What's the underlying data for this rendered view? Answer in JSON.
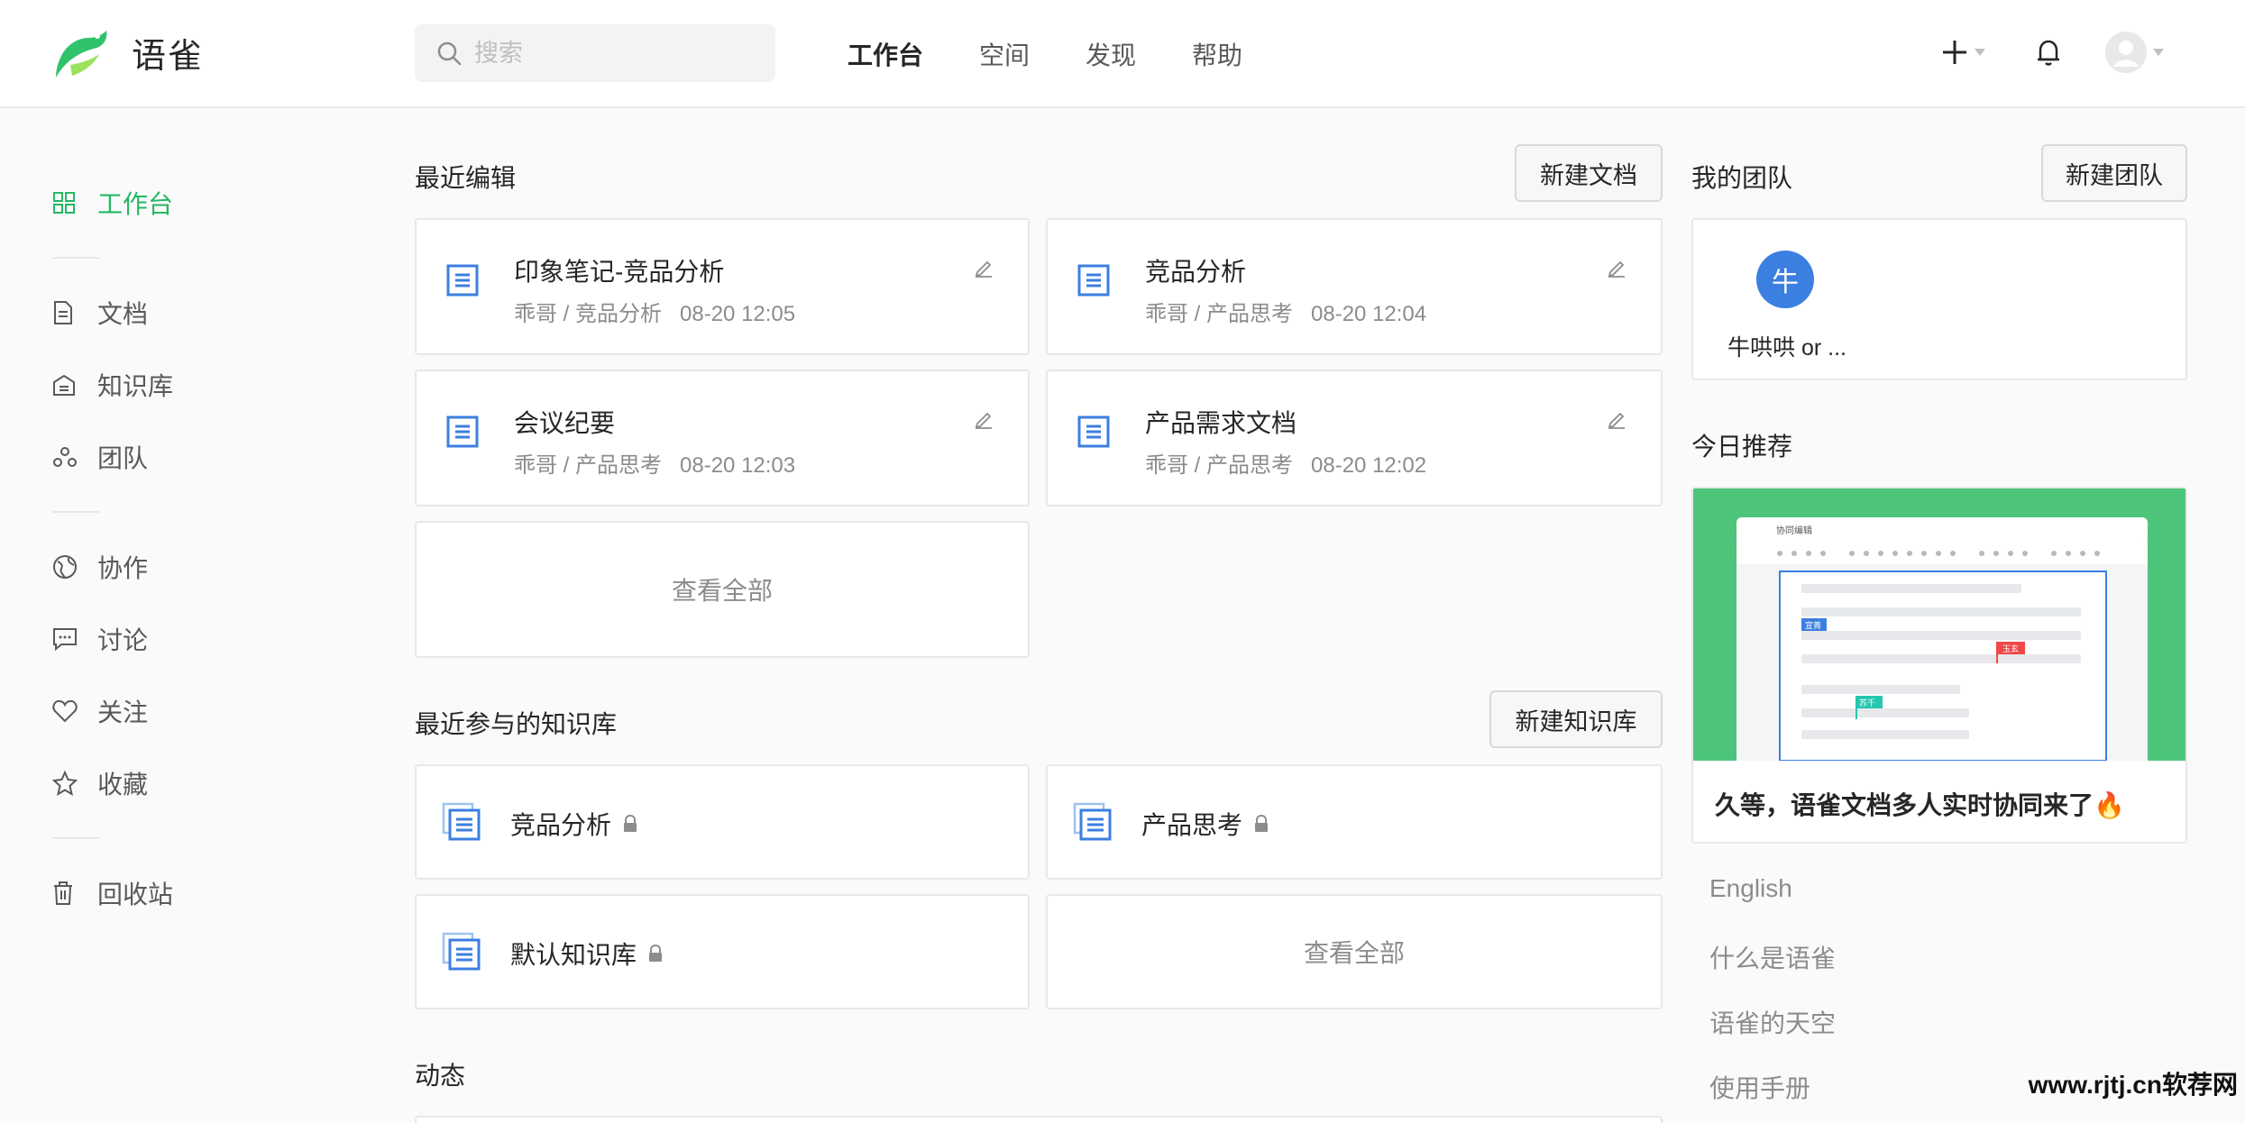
{
  "app": {
    "name": "语雀"
  },
  "search": {
    "placeholder": "搜索"
  },
  "nav": [
    {
      "label": "工作台",
      "active": true
    },
    {
      "label": "空间"
    },
    {
      "label": "发现"
    },
    {
      "label": "帮助"
    }
  ],
  "header_icons": [
    "plus-icon",
    "bell-icon",
    "avatar"
  ],
  "sidebar": {
    "items": [
      {
        "label": "工作台",
        "icon": "grid-icon",
        "active": true
      },
      {
        "label": "文档",
        "icon": "document-icon"
      },
      {
        "label": "知识库",
        "icon": "library-icon"
      },
      {
        "label": "团队",
        "icon": "team-icon"
      },
      {
        "label": "协作",
        "icon": "globe-icon"
      },
      {
        "label": "讨论",
        "icon": "chat-icon"
      },
      {
        "label": "关注",
        "icon": "heart-icon"
      },
      {
        "label": "收藏",
        "icon": "star-icon"
      },
      {
        "label": "回收站",
        "icon": "trash-icon"
      }
    ]
  },
  "recent": {
    "title": "最近编辑",
    "new_button": "新建文档",
    "docs": [
      {
        "title": "印象笔记-竞品分析",
        "path": "乖哥 / 竞品分析",
        "time": "08-20 12:05"
      },
      {
        "title": "竞品分析",
        "path": "乖哥 / 产品思考",
        "time": "08-20 12:04"
      },
      {
        "title": "会议纪要",
        "path": "乖哥 / 产品思考",
        "time": "08-20 12:03"
      },
      {
        "title": "产品需求文档",
        "path": "乖哥 / 产品思考",
        "time": "08-20 12:02"
      }
    ],
    "view_all": "查看全部"
  },
  "repos": {
    "title": "最近参与的知识库",
    "new_button": "新建知识库",
    "items": [
      {
        "title": "竞品分析",
        "locked": true
      },
      {
        "title": "产品思考",
        "locked": true
      },
      {
        "title": "默认知识库",
        "locked": true
      }
    ],
    "view_all": "查看全部"
  },
  "activity": {
    "title": "动态"
  },
  "teams": {
    "title": "我的团队",
    "new_button": "新建团队",
    "items": [
      {
        "avatar_char": "牛",
        "name": "牛哄哄 or ..."
      }
    ]
  },
  "recommend": {
    "title": "今日推荐",
    "card_title": "久等，语雀文档多人实时协同来了🔥",
    "preview": {
      "header": "协同编辑",
      "tags": [
        "宣菁",
        "玉玄",
        "苏千"
      ]
    }
  },
  "links": [
    "English",
    "什么是语雀",
    "语雀的天空",
    "使用手册"
  ],
  "watermark": "www.rjtj.cn软荐网",
  "colors": {
    "accent": "#25b864",
    "doc_blue": "#3b7fe0",
    "recommend_bg": "#4cc47a"
  }
}
